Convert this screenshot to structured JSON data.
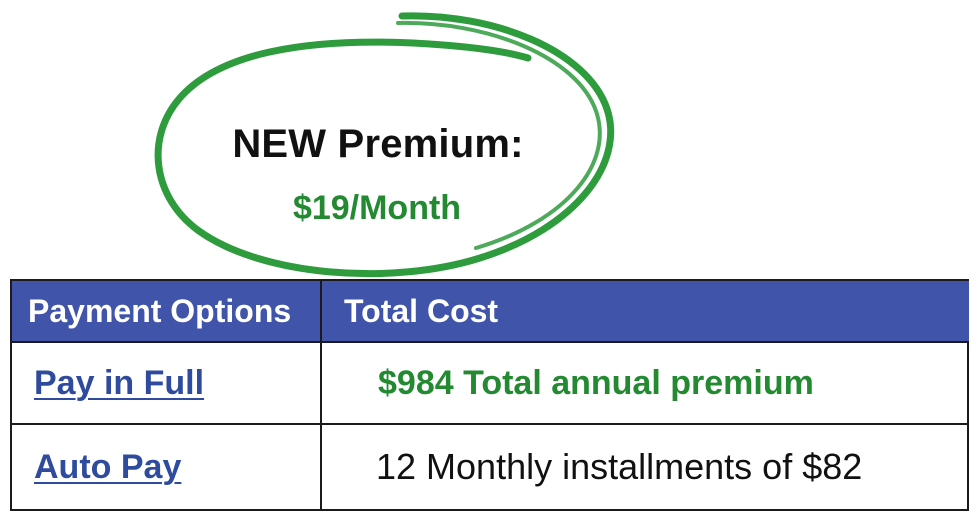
{
  "premium": {
    "heading": "NEW Premium:",
    "price": "$19/Month",
    "price_color": "#238a32",
    "circle_color": "#2e9b3d"
  },
  "table": {
    "header_bg": "#4054a9",
    "columns": [
      "Payment Options",
      "Total Cost"
    ],
    "rows": [
      {
        "option": "Pay in Full",
        "cost": "$984 Total annual premium"
      },
      {
        "option": "Auto Pay",
        "cost": "12 Monthly installments of $82"
      }
    ]
  }
}
